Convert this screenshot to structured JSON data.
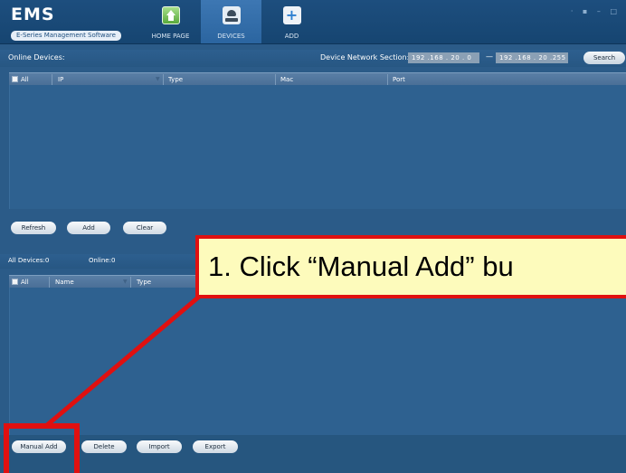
{
  "app": {
    "logo_title": "EMS",
    "logo_subtitle": "E-Series Management Software",
    "window_controls": "· ▪ – □"
  },
  "nav": {
    "tabs": [
      {
        "label": "HOME PAGE",
        "icon": "home-icon",
        "active": false
      },
      {
        "label": "DEVICES",
        "icon": "device-icon",
        "active": true
      },
      {
        "label": "ADD",
        "icon": "add-icon",
        "active": false
      }
    ]
  },
  "online": {
    "title": "Online Devices:",
    "network_label": "Device Network Section:",
    "ip_start": "192 .168 . 20 .  0",
    "ip_end": "192 .168 . 20 .255",
    "search_label": "Search",
    "columns": {
      "all": "All",
      "ip": "IP",
      "type": "Type",
      "mac": "Mac",
      "port": "Port"
    },
    "buttons": {
      "refresh": "Refresh",
      "add": "Add",
      "clear": "Clear"
    }
  },
  "devices": {
    "all_count": "All Devices:0",
    "online_count": "Online:0",
    "columns": {
      "all": "All",
      "name": "Name",
      "type": "Type"
    },
    "buttons": {
      "manual_add": "Manual Add",
      "delete": "Delete",
      "import": "Import",
      "export": "Export"
    }
  },
  "annotation": {
    "text": "1. Click “Manual Add” bu",
    "color": "#e01010"
  },
  "colors": {
    "panel_bg": "#2e6190",
    "header_bg": "#1d4e7e",
    "active_tab": "#3d77b3"
  }
}
